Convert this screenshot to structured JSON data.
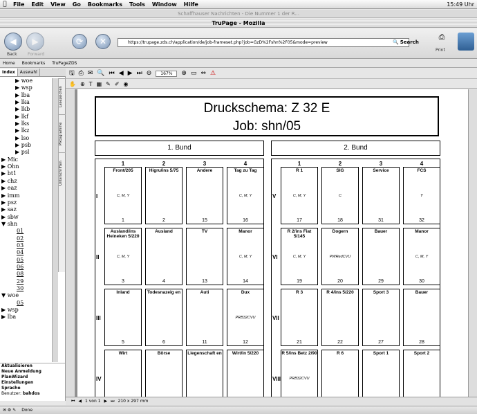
{
  "menubar": {
    "apple_glyph": "",
    "items": [
      "File",
      "Edit",
      "View",
      "Go",
      "Bookmarks",
      "Tools",
      "Window",
      "Hilfe"
    ],
    "clock": "15:49 Uhr"
  },
  "background_window_title": "Schaffhauser Nachrichten - Die Nummer 1 der R...",
  "window_title": "TruPage - Mozilla",
  "nav": {
    "back": "Back",
    "forward": "Forward",
    "url": "https://trupage.zds.ch/application/de/job-frameset.php?job=GzD%2Fshn%2F05&mode=preview",
    "search": "Search",
    "print": "Print"
  },
  "personal_toolbar": [
    "Home",
    "Bookmarks",
    "TruPageZDS"
  ],
  "sidebar": {
    "tabs": [
      "Index",
      "Auswahl"
    ],
    "tree": [
      {
        "label": "woe",
        "level": 1
      },
      {
        "label": "wsp",
        "level": 1
      },
      {
        "label": "lba",
        "level": 1
      },
      {
        "label": "lka",
        "level": 1
      },
      {
        "label": "lkb",
        "level": 1
      },
      {
        "label": "lkf",
        "level": 1
      },
      {
        "label": "lks",
        "level": 1
      },
      {
        "label": "lkz",
        "level": 1
      },
      {
        "label": "lso",
        "level": 1
      },
      {
        "label": "psb",
        "level": 1
      },
      {
        "label": "psl",
        "level": 1
      },
      {
        "label": "Mic",
        "level": 0
      },
      {
        "label": "Ohn",
        "level": 0
      },
      {
        "label": "bt1",
        "level": 0
      },
      {
        "label": "chz",
        "level": 0
      },
      {
        "label": "eaz",
        "level": 0
      },
      {
        "label": "imm",
        "level": 0
      },
      {
        "label": "psz",
        "level": 0
      },
      {
        "label": "saz",
        "level": 0
      },
      {
        "label": "sbw",
        "level": 0
      },
      {
        "label": "shn",
        "level": 0,
        "open": true
      },
      {
        "label": "01",
        "level": 2
      },
      {
        "label": "02",
        "level": 2
      },
      {
        "label": "03",
        "level": 2
      },
      {
        "label": "04",
        "level": 2
      },
      {
        "label": "05",
        "level": 2
      },
      {
        "label": "06",
        "level": 2
      },
      {
        "label": "08",
        "level": 2
      },
      {
        "label": "29",
        "level": 2
      },
      {
        "label": "30",
        "level": 2
      },
      {
        "label": "woe",
        "level": 0,
        "open": true
      },
      {
        "label": "05",
        "level": 2
      },
      {
        "label": "wsp",
        "level": 0
      },
      {
        "label": "lba",
        "level": 0
      }
    ],
    "vertical_tabs": [
      "Lesezeichen",
      "Piktogramme",
      "Unterschriften"
    ],
    "bottom_links": [
      "Aktualisieren",
      "Neue Anmeldung",
      "PlanWizard",
      "Einstellungen",
      "Sprache"
    ],
    "user_label": "Benutzer:",
    "user": "bahdos"
  },
  "pdf_toolbar": {
    "zoom": "167%",
    "page_status": "1 von 1",
    "page_size": "210 x 297 mm"
  },
  "status": {
    "text": "Done"
  },
  "document": {
    "title_line1": "Druckschema: Z 32 E",
    "title_line2": "Job: shn/05",
    "bund1": "1. Bund",
    "bund2": "2. Bund",
    "left": {
      "cols": [
        "1",
        "2",
        "3",
        "4"
      ],
      "rows": [
        {
          "roman": "I",
          "cells": [
            {
              "t": "Front/205",
              "c": "C, M, Y",
              "n": "1"
            },
            {
              "t": "Higru/ins 5/75",
              "c": "",
              "n": "2"
            },
            {
              "t": "Andere",
              "c": "",
              "n": "15"
            },
            {
              "t": "Tag zu Tag",
              "c": "C, M, Y",
              "n": "16"
            }
          ]
        },
        {
          "roman": "II",
          "cells": [
            {
              "t": "Ausland/ins Heineken 5/220",
              "c": "C, M, Y",
              "n": "3"
            },
            {
              "t": "Ausland",
              "c": "",
              "n": "4"
            },
            {
              "t": "TV",
              "c": "",
              "n": "13"
            },
            {
              "t": "Manor",
              "c": "C, M, Y",
              "n": "14"
            }
          ]
        },
        {
          "roman": "III",
          "cells": [
            {
              "t": "Inland",
              "c": "",
              "n": "5"
            },
            {
              "t": "Todesnazeig en",
              "c": "",
              "n": "6"
            },
            {
              "t": "Auti",
              "c": "",
              "n": "11"
            },
            {
              "t": "Dux",
              "c": "PRB32CVU",
              "n": "12"
            }
          ]
        },
        {
          "roman": "IV",
          "cells": [
            {
              "t": "Wirt",
              "c": "",
              "n": ""
            },
            {
              "t": "Börse",
              "c": "",
              "n": ""
            },
            {
              "t": "Liegenschaft en",
              "c": "",
              "n": ""
            },
            {
              "t": "Wirt/in 5/220",
              "c": "",
              "n": ""
            }
          ]
        }
      ]
    },
    "right": {
      "cols": [
        "1",
        "2",
        "3",
        "4"
      ],
      "rows": [
        {
          "roman": "V",
          "cells": [
            {
              "t": "R 1",
              "c": "C, M, Y",
              "n": "17"
            },
            {
              "t": "SIG",
              "c": "C",
              "n": "18"
            },
            {
              "t": "Service",
              "c": "",
              "n": "31"
            },
            {
              "t": "FCS",
              "c": "Y",
              "n": "32"
            }
          ]
        },
        {
          "roman": "VI",
          "cells": [
            {
              "t": "R 2/ins Fiat 5/145",
              "c": "C, M, Y",
              "n": "19"
            },
            {
              "t": "Dogern",
              "c": "PWRedCVU",
              "n": "20"
            },
            {
              "t": "Bauer",
              "c": "",
              "n": "29"
            },
            {
              "t": "Manor",
              "c": "C, M, Y",
              "n": "30"
            }
          ]
        },
        {
          "roman": "VII",
          "cells": [
            {
              "t": "R 3",
              "c": "",
              "n": "21"
            },
            {
              "t": "R 4/ins 5/220",
              "c": "",
              "n": "22"
            },
            {
              "t": "Sport 3",
              "c": "",
              "n": "27"
            },
            {
              "t": "Bauer",
              "c": "",
              "n": "28"
            }
          ]
        },
        {
          "roman": "VIII",
          "cells": [
            {
              "t": "R 5/ins Betz 2/90",
              "c": "PRB32CVU",
              "n": ""
            },
            {
              "t": "R 6",
              "c": "",
              "n": ""
            },
            {
              "t": "Sport 1",
              "c": "",
              "n": ""
            },
            {
              "t": "Sport 2",
              "c": "",
              "n": ""
            }
          ]
        }
      ]
    }
  }
}
